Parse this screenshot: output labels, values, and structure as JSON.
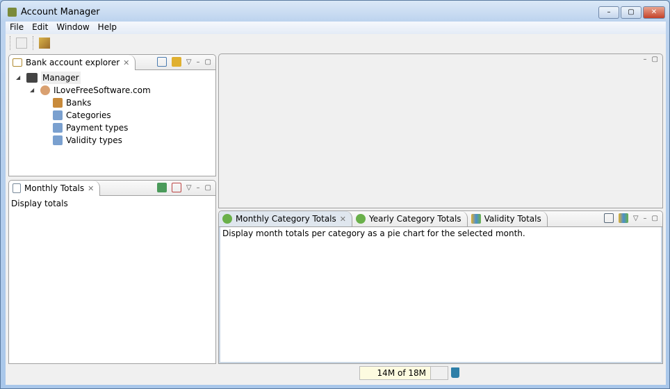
{
  "window": {
    "title": "Account Manager",
    "minimize": "–",
    "maximize": "▢",
    "close": "✕"
  },
  "menu": [
    "File",
    "Edit",
    "Window",
    "Help"
  ],
  "explorer": {
    "title": "Bank account explorer",
    "tree": {
      "root": "Manager",
      "user": "ILoveFreeSoftware.com",
      "children": [
        "Banks",
        "Categories",
        "Payment types",
        "Validity types"
      ]
    }
  },
  "monthly": {
    "title": "Monthly Totals",
    "text": "Display totals"
  },
  "bottom": {
    "tabs": [
      "Monthly Category Totals",
      "Yearly Category Totals",
      "Validity Totals"
    ],
    "text": "Display month totals per category as a pie chart for the selected month."
  },
  "status": {
    "heap": "14M of 18M"
  },
  "icons": {
    "close": "✕",
    "menu": "▽",
    "min": "–",
    "max": "▢"
  }
}
